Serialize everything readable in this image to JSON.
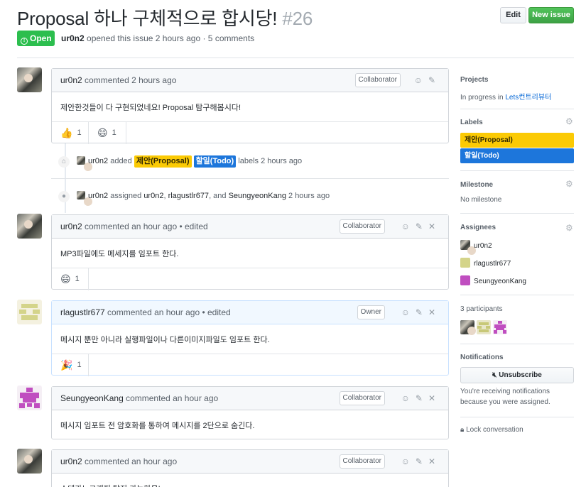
{
  "header": {
    "title": "Proposal 하나 구체적으로 합시당!",
    "number": "#26",
    "edit_label": "Edit",
    "new_issue_label": "New issue",
    "state_label": "Open",
    "author": "ur0n2",
    "meta_text": "opened this issue 2 hours ago · 5 comments"
  },
  "comments": [
    {
      "author": "ur0n2",
      "header_text": "commented 2 hours ago",
      "role": "Collaborator",
      "body": "제안한것들이 다 구현되었네요! Proposal 탐구해봅시다!",
      "reactions": [
        {
          "emoji": "👍",
          "count": "1"
        },
        {
          "emoji": "😄",
          "count": "1"
        }
      ]
    },
    {
      "author": "ur0n2",
      "header_text": "commented an hour ago • edited",
      "role": "Collaborator",
      "body": "MP3파일에도 메세지를 임포트 한다.",
      "reactions": [
        {
          "emoji": "😄",
          "count": "1"
        }
      ]
    },
    {
      "author": "rlagustlr677",
      "header_text": "commented an hour ago • edited",
      "role": "Owner",
      "body": "메시지 뿐만 아니라 실행파일이나 다른이미지파일도 임포트 한다.",
      "reactions": [
        {
          "emoji": "🎉",
          "count": "1"
        }
      ]
    },
    {
      "author": "SeungyeonKang",
      "header_text": "commented an hour ago",
      "role": "Collaborator",
      "body": "메시지 임포트 전 암호화를 통하여 메시지를 2단으로 숨긴다."
    },
    {
      "author": "ur0n2",
      "header_text": "commented an hour ago",
      "role": "Collaborator",
      "body": "스테가노그래피 탐지 가능하옵!"
    }
  ],
  "events": {
    "labels_event": {
      "actor": "ur0n2",
      "verb": "added",
      "label1": "제안(Proposal)",
      "label2": "할일(Todo)",
      "suffix": "labels 2 hours ago"
    },
    "assign_event": {
      "actor": "ur0n2",
      "verb": "assigned",
      "a1": "ur0n2",
      "a2": "rlagustlr677",
      "conj": ", and",
      "a3": "SeungyeonKang",
      "suffix": "2 hours ago"
    }
  },
  "sidebar": {
    "projects_heading": "Projects",
    "project_status": "In progress in",
    "project_name": "Lets컨트리뷰터",
    "labels_heading": "Labels",
    "labels": [
      {
        "name": "제안(Proposal)",
        "color": "#fbca04"
      },
      {
        "name": "할일(Todo)",
        "color": "#1d76db"
      }
    ],
    "milestone_heading": "Milestone",
    "milestone_value": "No milestone",
    "assignees_heading": "Assignees",
    "assignees": [
      "ur0n2",
      "rlagustlr677",
      "SeungyeonKang"
    ],
    "participants_heading": "3 participants",
    "notifications_heading": "Notifications",
    "unsubscribe_label": "Unsubscribe",
    "notification_note_1": "You're receiving notifications",
    "notification_note_2": "because you were assigned.",
    "lock_label": "Lock conversation"
  },
  "colors": {
    "open_green": "#2cbe4e",
    "new_issue_green": "#3da145",
    "label_proposal": "#fbca04",
    "label_todo": "#1d76db",
    "owner_header_bg": "#f1f8ff"
  }
}
